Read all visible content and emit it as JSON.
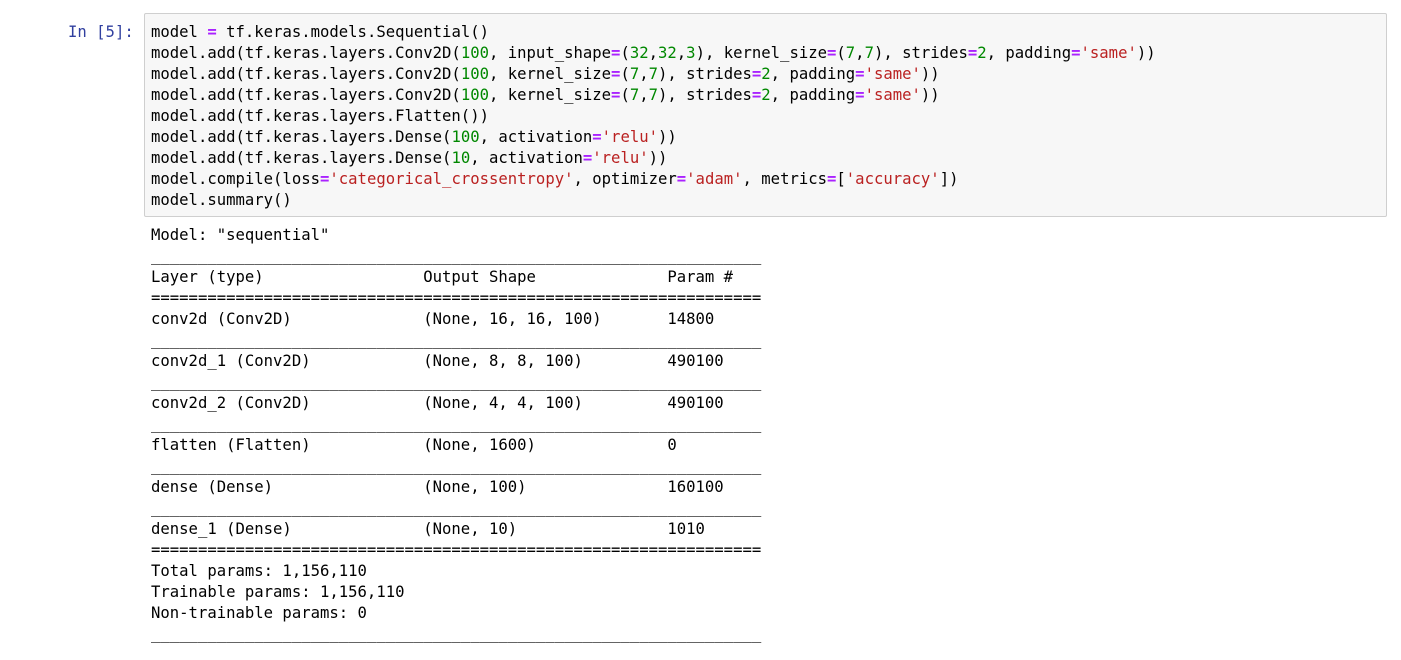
{
  "cell": {
    "prompt": "In [5]:",
    "code_lines": [
      [
        {
          "t": "model "
        },
        {
          "t": "=",
          "k": "op"
        },
        {
          "t": " tf.keras.models.Sequential()"
        }
      ],
      [
        {
          "t": "model.add(tf.keras.layers.Conv2D("
        },
        {
          "t": "100",
          "k": "num"
        },
        {
          "t": ", input_shape"
        },
        {
          "t": "=",
          "k": "op"
        },
        {
          "t": "("
        },
        {
          "t": "32",
          "k": "num"
        },
        {
          "t": ","
        },
        {
          "t": "32",
          "k": "num"
        },
        {
          "t": ","
        },
        {
          "t": "3",
          "k": "num"
        },
        {
          "t": "), kernel_size"
        },
        {
          "t": "=",
          "k": "op"
        },
        {
          "t": "("
        },
        {
          "t": "7",
          "k": "num"
        },
        {
          "t": ","
        },
        {
          "t": "7",
          "k": "num"
        },
        {
          "t": "), strides"
        },
        {
          "t": "=",
          "k": "op"
        },
        {
          "t": "2",
          "k": "num"
        },
        {
          "t": ", padding"
        },
        {
          "t": "=",
          "k": "op"
        },
        {
          "t": "'same'",
          "k": "str"
        },
        {
          "t": "))"
        }
      ],
      [
        {
          "t": "model.add(tf.keras.layers.Conv2D("
        },
        {
          "t": "100",
          "k": "num"
        },
        {
          "t": ", kernel_size"
        },
        {
          "t": "=",
          "k": "op"
        },
        {
          "t": "("
        },
        {
          "t": "7",
          "k": "num"
        },
        {
          "t": ","
        },
        {
          "t": "7",
          "k": "num"
        },
        {
          "t": "), strides"
        },
        {
          "t": "=",
          "k": "op"
        },
        {
          "t": "2",
          "k": "num"
        },
        {
          "t": ", padding"
        },
        {
          "t": "=",
          "k": "op"
        },
        {
          "t": "'same'",
          "k": "str"
        },
        {
          "t": "))"
        }
      ],
      [
        {
          "t": "model.add(tf.keras.layers.Conv2D("
        },
        {
          "t": "100",
          "k": "num"
        },
        {
          "t": ", kernel_size"
        },
        {
          "t": "=",
          "k": "op"
        },
        {
          "t": "("
        },
        {
          "t": "7",
          "k": "num"
        },
        {
          "t": ","
        },
        {
          "t": "7",
          "k": "num"
        },
        {
          "t": "), strides"
        },
        {
          "t": "=",
          "k": "op"
        },
        {
          "t": "2",
          "k": "num"
        },
        {
          "t": ", padding"
        },
        {
          "t": "=",
          "k": "op"
        },
        {
          "t": "'same'",
          "k": "str"
        },
        {
          "t": "))"
        }
      ],
      [
        {
          "t": "model.add(tf.keras.layers.Flatten())"
        }
      ],
      [
        {
          "t": "model.add(tf.keras.layers.Dense("
        },
        {
          "t": "100",
          "k": "num"
        },
        {
          "t": ", activation"
        },
        {
          "t": "=",
          "k": "op"
        },
        {
          "t": "'relu'",
          "k": "str"
        },
        {
          "t": "))"
        }
      ],
      [
        {
          "t": "model.add(tf.keras.layers.Dense("
        },
        {
          "t": "10",
          "k": "num"
        },
        {
          "t": ", activation"
        },
        {
          "t": "=",
          "k": "op"
        },
        {
          "t": "'relu'",
          "k": "str"
        },
        {
          "t": "))"
        }
      ],
      [
        {
          "t": "model.compile(loss"
        },
        {
          "t": "=",
          "k": "op"
        },
        {
          "t": "'categorical_crossentropy'",
          "k": "str"
        },
        {
          "t": ", optimizer"
        },
        {
          "t": "=",
          "k": "op"
        },
        {
          "t": "'adam'",
          "k": "str"
        },
        {
          "t": ", metrics"
        },
        {
          "t": "=",
          "k": "op"
        },
        {
          "t": "["
        },
        {
          "t": "'accuracy'",
          "k": "str"
        },
        {
          "t": "])"
        }
      ],
      [
        {
          "t": "model.summary()"
        }
      ]
    ]
  },
  "output": {
    "model_name_line": "Model: \"sequential\"",
    "underscore_line": "_________________________________________________________________",
    "equals_line": "=================================================================",
    "header": {
      "layer": "Layer (type)",
      "output_shape": "Output Shape",
      "params": "Param #"
    },
    "rows": [
      {
        "layer": "conv2d (Conv2D)",
        "output_shape": "(None, 16, 16, 100)",
        "params": "14800"
      },
      {
        "layer": "conv2d_1 (Conv2D)",
        "output_shape": "(None, 8, 8, 100)",
        "params": "490100"
      },
      {
        "layer": "conv2d_2 (Conv2D)",
        "output_shape": "(None, 4, 4, 100)",
        "params": "490100"
      },
      {
        "layer": "flatten (Flatten)",
        "output_shape": "(None, 1600)",
        "params": "0"
      },
      {
        "layer": "dense (Dense)",
        "output_shape": "(None, 100)",
        "params": "160100"
      },
      {
        "layer": "dense_1 (Dense)",
        "output_shape": "(None, 10)",
        "params": "1010"
      }
    ],
    "total_params": "Total params: 1,156,110",
    "trainable_params": "Trainable params: 1,156,110",
    "non_trainable_params": "Non-trainable params: 0"
  },
  "colors": {
    "prompt": "#303f9f",
    "operator": "#aa22ff",
    "number": "#008800",
    "string": "#ba2121",
    "input_background": "#f7f7f7",
    "input_border": "#cfcfcf"
  }
}
